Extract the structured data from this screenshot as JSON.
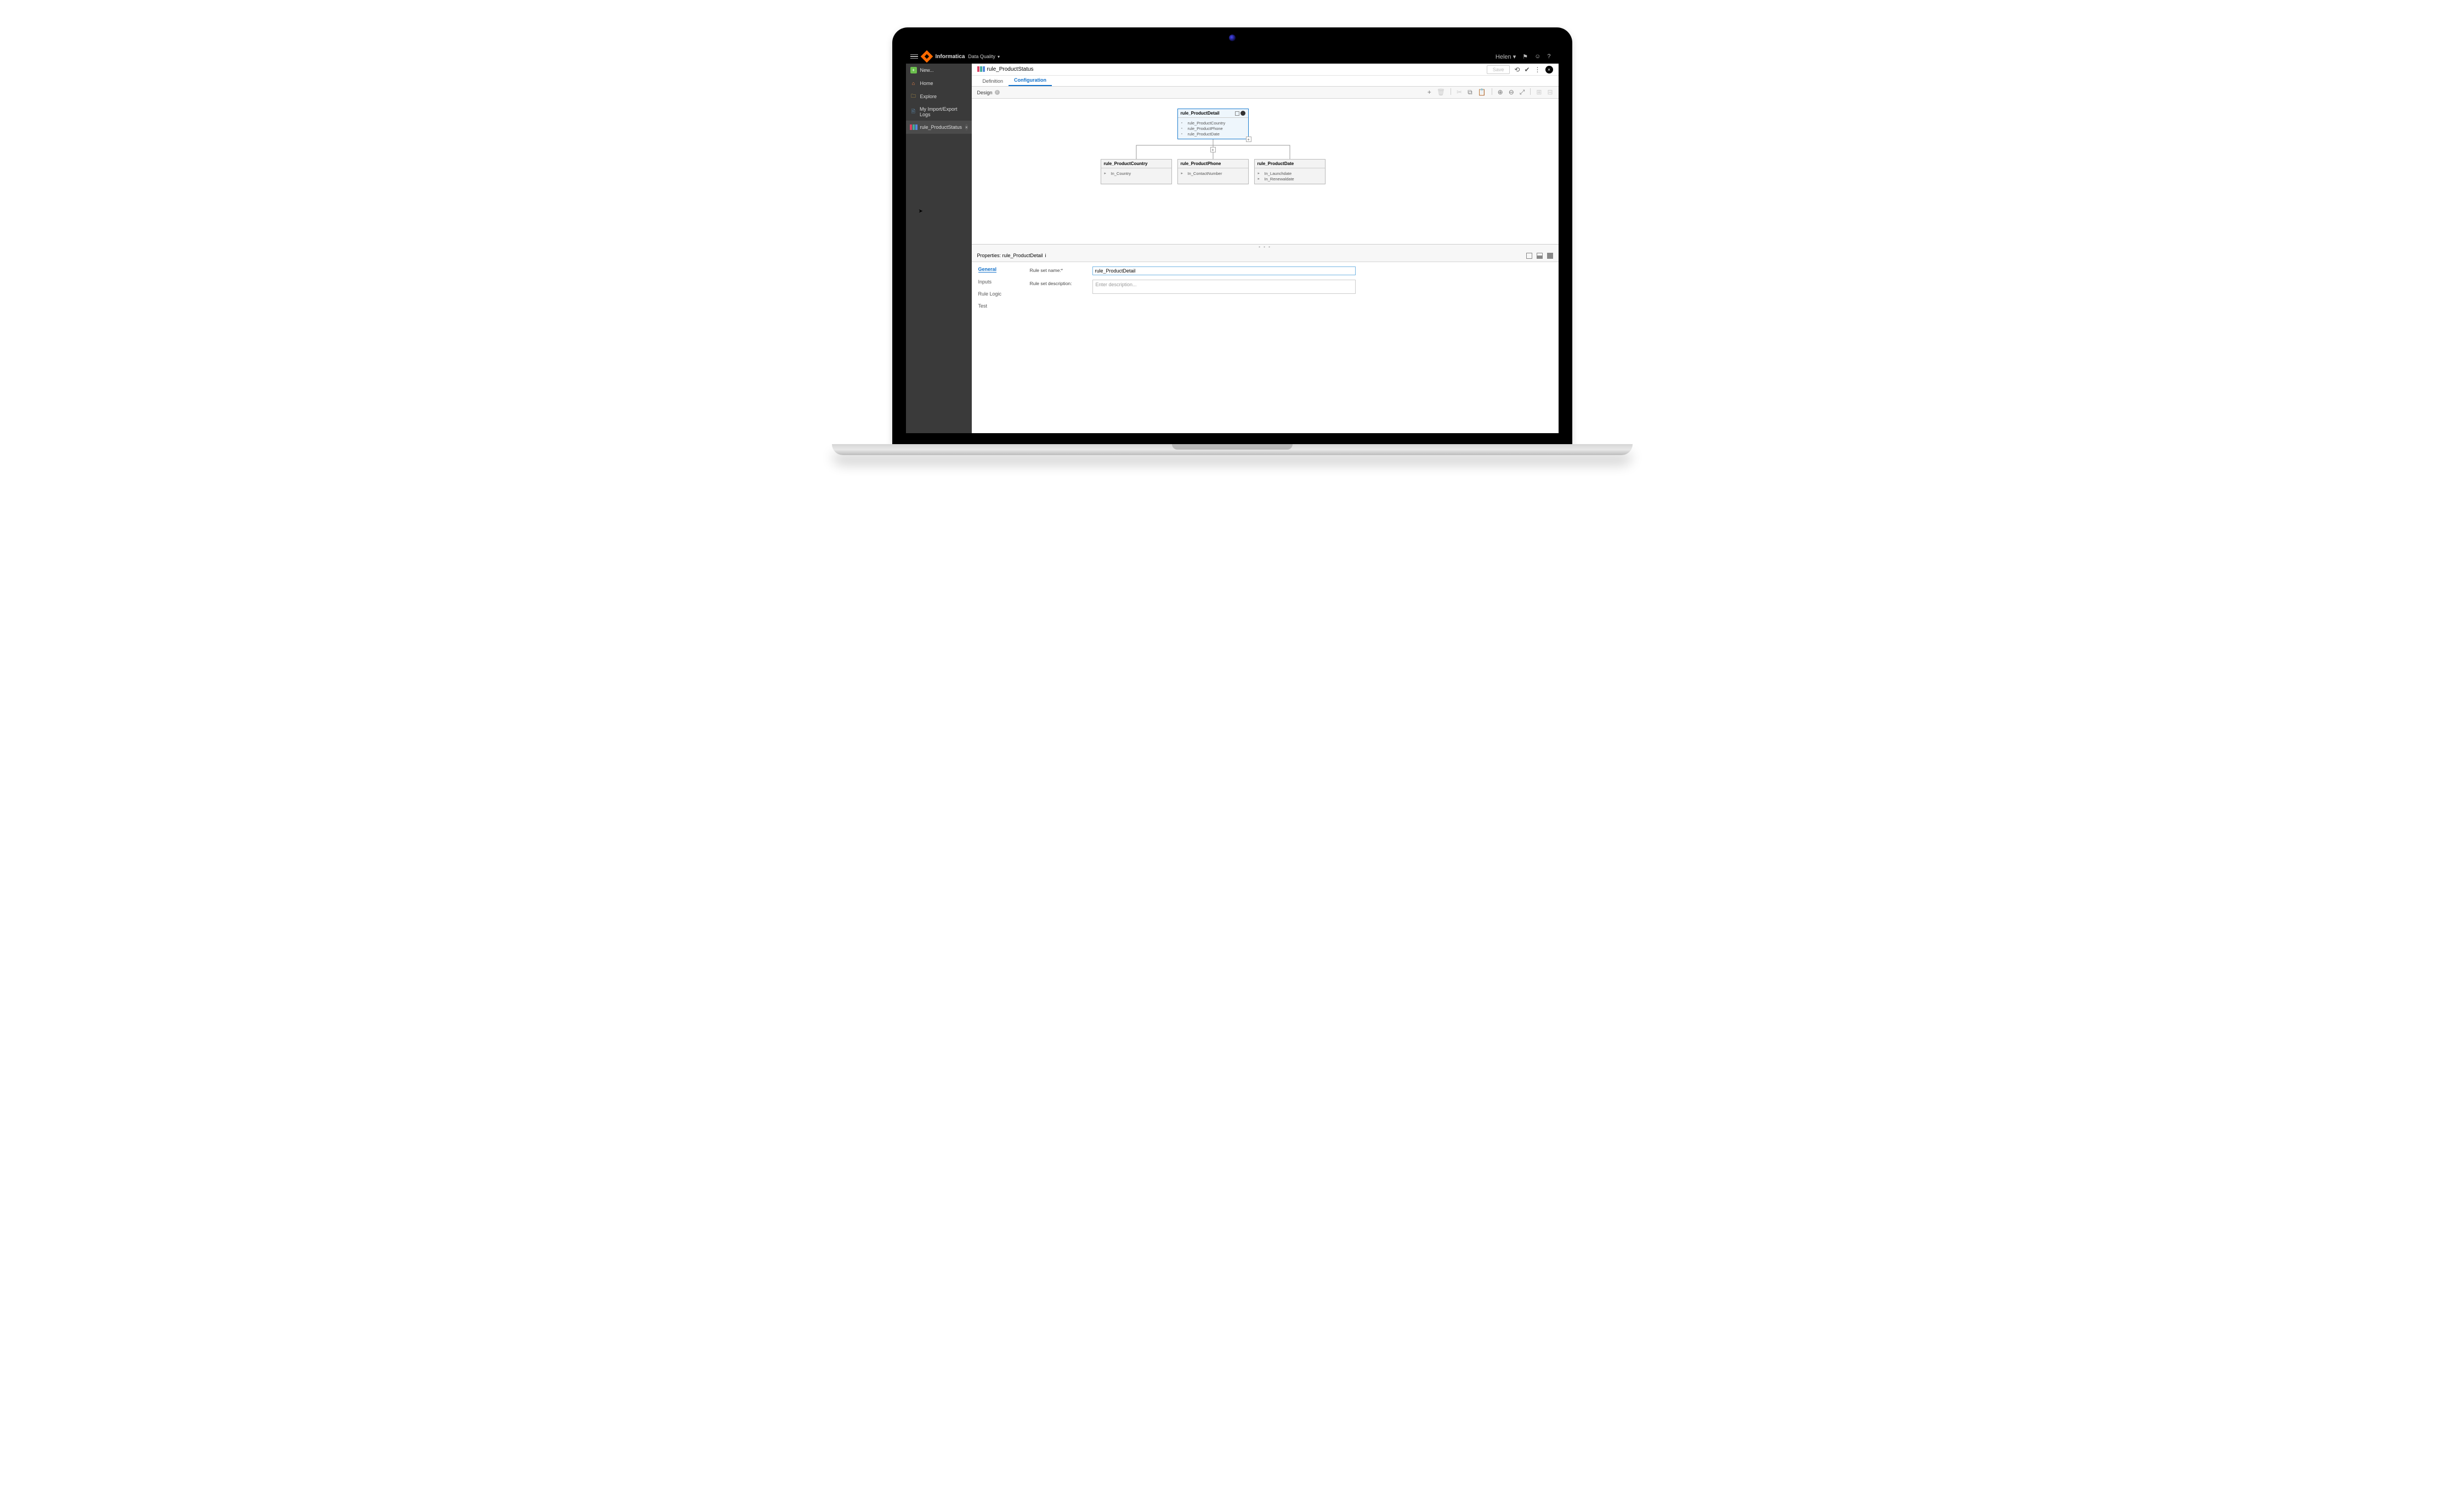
{
  "header": {
    "brand": "Informatica",
    "module": "Data Quality",
    "user": "Helen"
  },
  "sidebar": {
    "items": [
      {
        "label": "New..."
      },
      {
        "label": "Home"
      },
      {
        "label": "Explore"
      },
      {
        "label": "My Import/Export Logs"
      },
      {
        "label": "rule_ProductStatus"
      }
    ]
  },
  "titlebar": {
    "asset_name": "rule_ProductStatus",
    "save_label": "Save"
  },
  "subtabs": {
    "definition": "Definition",
    "configuration": "Configuration"
  },
  "design": {
    "label": "Design"
  },
  "nodes": {
    "parent": {
      "title": "rule_ProductDetail",
      "rows": [
        "rule_ProductCountry",
        "rule_ProductPhone",
        "rule_ProductDate"
      ]
    },
    "child1": {
      "title": "rule_ProductCountry",
      "rows": [
        "In_Country"
      ]
    },
    "child2": {
      "title": "rule_ProductPhone",
      "rows": [
        "In_ContactNumber"
      ]
    },
    "child3": {
      "title": "rule_ProductDate",
      "rows": [
        "In_Launchdate",
        "In_Renewaldate"
      ]
    }
  },
  "properties": {
    "heading": "Properties: rule_ProductDetail",
    "tabs": {
      "general": "General",
      "inputs": "Inputs",
      "rule_logic": "Rule Logic",
      "test": "Test"
    },
    "fields": {
      "name_label": "Rule set name:*",
      "name_value": "rule_ProductDetail",
      "desc_label": "Rule set description:",
      "desc_placeholder": "Enter description..."
    }
  }
}
